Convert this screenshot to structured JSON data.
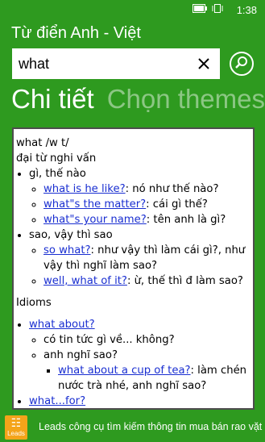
{
  "status": {
    "time": "1:38"
  },
  "app": {
    "title": "Từ điển Anh - Việt"
  },
  "search": {
    "value": "what"
  },
  "pivot": {
    "active": "Chi tiết",
    "inactive": "Chọn themes"
  },
  "entry": {
    "headword": "what /w t/",
    "pos": "đại từ nghi vấn",
    "sense1": {
      "meaning": "gì, thế nào",
      "examples": [
        {
          "phrase": "what is he like?",
          "translation": ": nó như thế nào?"
        },
        {
          "phrase": "what\"s the matter?",
          "translation": ": cái gì thế?"
        },
        {
          "phrase": "what\"s your name?",
          "translation": ": tên anh là gì?"
        }
      ]
    },
    "sense2": {
      "meaning": "sao, vậy thì sao",
      "examples": [
        {
          "phrase": "so what?",
          "translation": ": như vậy thì làm cái gì?, như vậy thì nghĩ làm sao?"
        },
        {
          "phrase": "well, what of it?",
          "translation": ": ừ, thế thì đ làm sao?"
        }
      ]
    },
    "idioms_label": "Idioms",
    "idiom1": {
      "phrase": "what about?",
      "meanings": [
        "có tin tức gì về... không?",
        "anh nghĩ sao?"
      ],
      "example": {
        "phrase": "what about a cup of tea?",
        "translation": ": làm chén nước trà nhé, anh nghĩ sao?"
      }
    },
    "idiom2": {
      "phrase": "what...for?"
    }
  },
  "ad": {
    "logo_text": "Leads",
    "text": "Leads công cụ tìm kiếm thông tin mua bán rao vặt"
  },
  "colors": {
    "background": "#2e9a1f",
    "link": "#1a2fd1",
    "ad_logo": "#f4a41a"
  }
}
